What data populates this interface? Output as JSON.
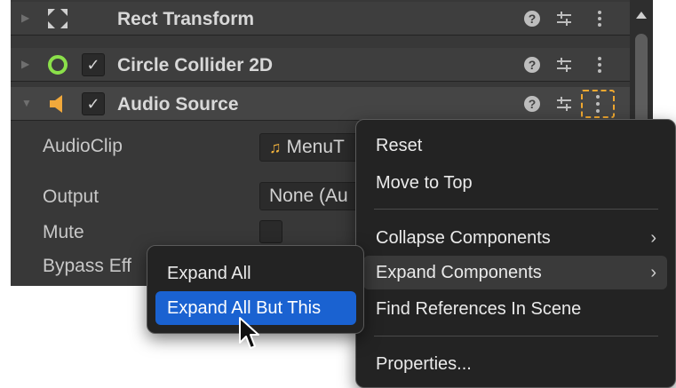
{
  "components": [
    {
      "title": "Rect Transform",
      "icon": "rect-transform-icon",
      "has_checkbox": false,
      "expanded": false
    },
    {
      "title": "Circle Collider 2D",
      "icon": "circle-collider-icon",
      "has_checkbox": true,
      "checked": true,
      "expanded": false
    },
    {
      "title": "Audio Source",
      "icon": "audio-source-icon",
      "has_checkbox": true,
      "checked": true,
      "expanded": true
    }
  ],
  "header_icons": [
    "help-icon",
    "presets-icon",
    "more-options-icon"
  ],
  "audio_source": {
    "properties": [
      {
        "label": "AudioClip",
        "value": "MenuT"
      },
      {
        "label": "Output",
        "value": "None (Au"
      },
      {
        "label": "Mute",
        "value": ""
      },
      {
        "label": "Bypass Eff",
        "value": ""
      }
    ]
  },
  "context_menu": {
    "items": [
      {
        "label": "Reset",
        "has_submenu": false
      },
      {
        "label": "Move to Top",
        "has_submenu": false
      },
      {
        "label": "Collapse Components",
        "has_submenu": true
      },
      {
        "label": "Expand Components",
        "has_submenu": true,
        "hover": true
      },
      {
        "label": "Find References In Scene",
        "has_submenu": false
      },
      {
        "label": "Properties...",
        "has_submenu": false
      }
    ],
    "arrow": "›"
  },
  "submenu": {
    "items": [
      {
        "label": "Expand All",
        "selected": false
      },
      {
        "label": "Expand All But This",
        "selected": true
      }
    ]
  },
  "glyphs": {
    "check": "✓",
    "foldout_closed": "▶",
    "foldout_open": "▼",
    "note": "♫"
  },
  "colors": {
    "panel_bg": "#383838",
    "menu_bg": "#232323",
    "selection": "#1a62d1",
    "focus_outline": "#f0a830",
    "collider_green": "#8be04a",
    "audio_orange": "#f2a93b"
  }
}
